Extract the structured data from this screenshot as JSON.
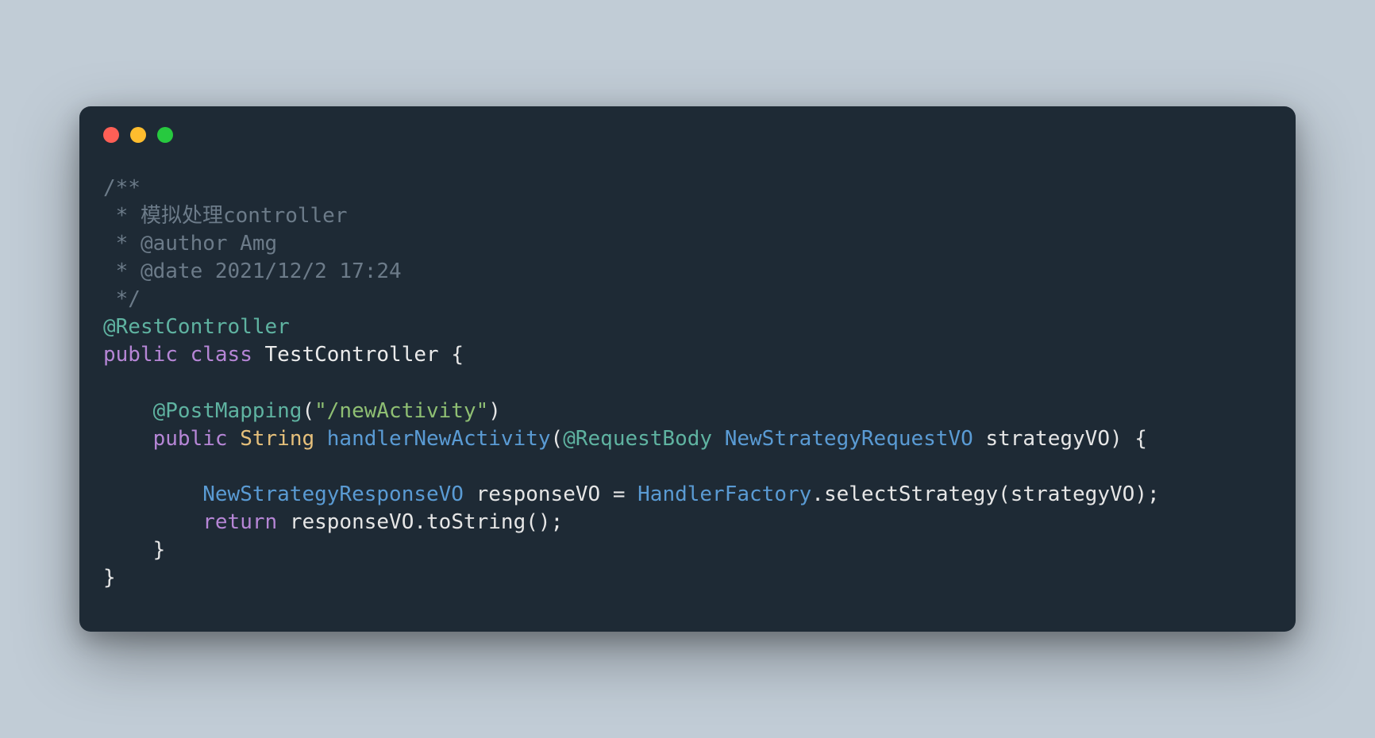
{
  "comment": {
    "l1": "/**",
    "l2": " * 模拟处理controller",
    "l3": " * @author Amg",
    "l4": " * @date 2021/12/2 17:24",
    "l5": " */"
  },
  "code": {
    "annotation_rest": "@RestController",
    "kw_public": "public",
    "kw_class": "class",
    "class_name": "TestController",
    "brace_open": " {",
    "empty": "",
    "indent1": "    ",
    "indent2": "        ",
    "annotation_post": "@PostMapping",
    "paren_open": "(",
    "string_path": "\"/newActivity\"",
    "paren_close": ")",
    "type_string": "String",
    "method_name": "handlerNewActivity",
    "param_anno": "@RequestBody",
    "param_type": "NewStrategyRequestVO",
    "param_name": "strategyVO",
    "brace_open2": " {",
    "resp_type": "NewStrategyResponseVO",
    "resp_var": "responseVO",
    "equals": " = ",
    "factory": "HandlerFactory",
    "dot": ".",
    "select_method": "selectStrategy",
    "arg": "strategyVO",
    "semi": ";",
    "kw_return": "return",
    "space": " ",
    "tostring": "toString",
    "empty_parens": "()",
    "brace_close_inner": "    }",
    "brace_close_outer": "}"
  }
}
